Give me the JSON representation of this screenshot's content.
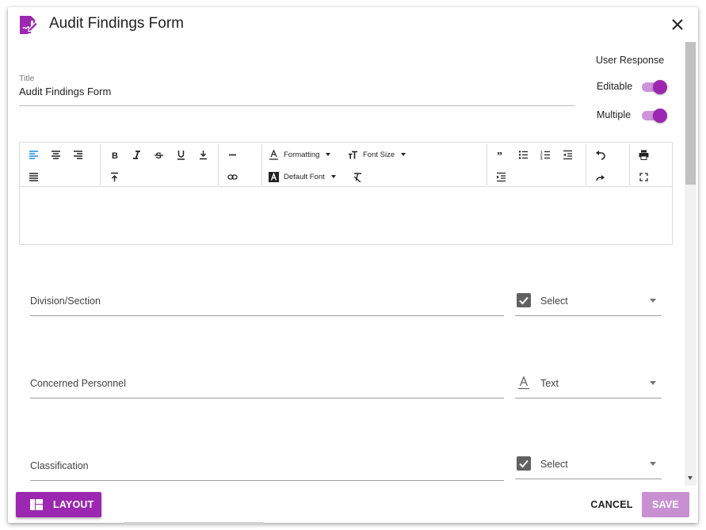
{
  "dialog": {
    "title": "Audit Findings Form",
    "icon": "edit-document-icon",
    "accent_color": "#9c27b0"
  },
  "form": {
    "title_label": "Title",
    "title_value": "Audit Findings Form"
  },
  "user_response": {
    "heading": "User Response",
    "editable_label": "Editable",
    "editable_on": true,
    "multiple_label": "Multiple",
    "multiple_on": true
  },
  "toolbar": {
    "formatting_label": "Formatting",
    "font_size_label": "Font Size",
    "default_font_label": "Default Font"
  },
  "fields": [
    {
      "label": "Division/Section",
      "type": "Select",
      "type_icon": "checkbox-icon"
    },
    {
      "label": "Concerned Personnel",
      "type": "Text",
      "type_icon": "text-format-icon"
    },
    {
      "label": "Classification",
      "type": "Select",
      "type_icon": "checkbox-icon"
    }
  ],
  "footer": {
    "layout_label": "LAYOUT",
    "cancel_label": "CANCEL",
    "save_label": "SAVE"
  }
}
